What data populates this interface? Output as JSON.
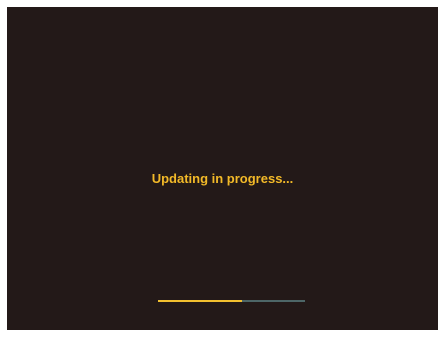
{
  "update_screen": {
    "message": "Updating in progress...",
    "progress": 0.57,
    "colors": {
      "background": "#231918",
      "message": "#f2b928",
      "progress_fill": "#f2c02f",
      "progress_track": "#4d6667"
    }
  }
}
